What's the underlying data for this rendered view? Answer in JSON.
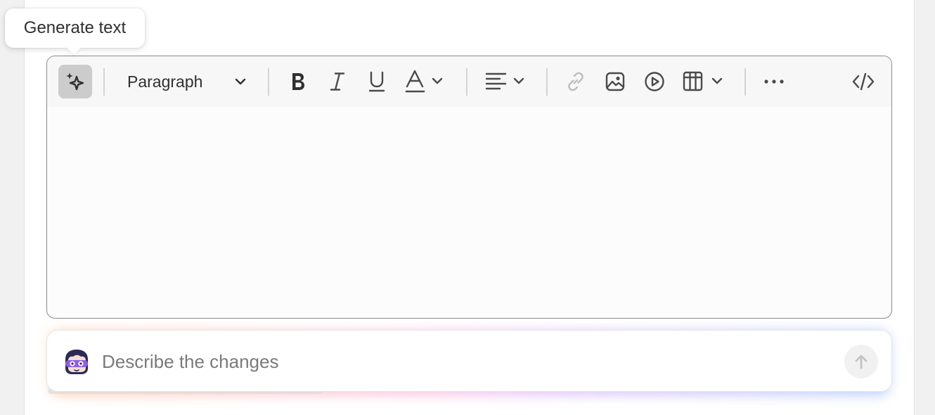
{
  "tooltip": {
    "text": "Generate text"
  },
  "toolbar": {
    "generate_icon": "sparkle-icon",
    "block_format": {
      "selected": "Paragraph"
    },
    "icons": {
      "bold": "bold-icon",
      "italic": "italic-icon",
      "underline": "underline-icon",
      "text_color": "text-color-icon",
      "align": "align-left-icon",
      "link": "link-icon",
      "image": "image-icon",
      "video": "play-circle-icon",
      "table": "table-icon",
      "more": "more-horizontal-icon",
      "html": "code-icon"
    }
  },
  "editor": {
    "content": ""
  },
  "ai_prompt": {
    "placeholder": "Describe the changes",
    "value": "",
    "avatar_icon": "assistant-avatar-icon",
    "send_icon": "arrow-up-icon"
  },
  "colors": {
    "link_disabled": "#bdbdbd",
    "active_tool_bg": "#cccccc",
    "glow_start": "#ffaa78",
    "glow_end": "#82aaff"
  }
}
